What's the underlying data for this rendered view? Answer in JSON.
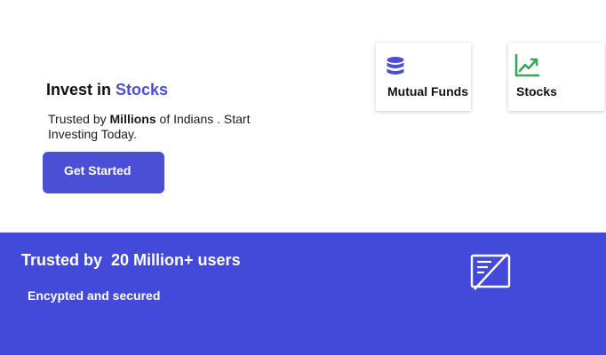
{
  "hero": {
    "title_prefix": "Invest in ",
    "title_accent": "Stocks",
    "subtitle_prefix": "Trusted by ",
    "subtitle_bold": "Millions",
    "subtitle_suffix": " of Indians . Start Investing Today.",
    "cta_label": "Get Started"
  },
  "cards": [
    {
      "label": "Mutual Funds",
      "icon": "database-icon"
    },
    {
      "label": "Stocks",
      "icon": "trending-up-chart-icon"
    }
  ],
  "band": {
    "title": "Trusted by  20 Million+ users",
    "subtitle": "Encypted and secured",
    "icon": "secure-document-icon"
  },
  "colors": {
    "accent": "#4a4fd6",
    "band_background": "#4349d8",
    "chart_icon": "#3aa655"
  }
}
